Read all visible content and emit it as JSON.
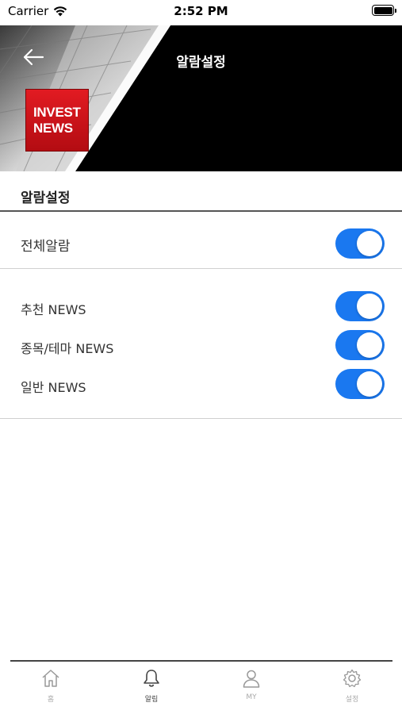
{
  "status_bar": {
    "carrier": "Carrier",
    "time": "2:52 PM"
  },
  "header": {
    "title": "알람설정",
    "logo_line1": "INVEST",
    "logo_line2": "NEWS"
  },
  "section": {
    "title": "알람설정"
  },
  "settings": {
    "all": {
      "label": "전체알람",
      "enabled": true
    },
    "items": [
      {
        "label": "추천 NEWS",
        "enabled": true
      },
      {
        "label": "종목/테마 NEWS",
        "enabled": true
      },
      {
        "label": "일반 NEWS",
        "enabled": true
      }
    ]
  },
  "tab_bar": {
    "tabs": [
      {
        "label": "홈",
        "icon": "home-icon",
        "active": false
      },
      {
        "label": "알림",
        "icon": "bell-icon",
        "active": true
      },
      {
        "label": "MY",
        "icon": "person-icon",
        "active": false
      },
      {
        "label": "설정",
        "icon": "gear-icon",
        "active": false
      }
    ]
  },
  "colors": {
    "toggle_on": "#1a78f0",
    "logo_red": "#e21b22",
    "header_bg": "#000000"
  }
}
